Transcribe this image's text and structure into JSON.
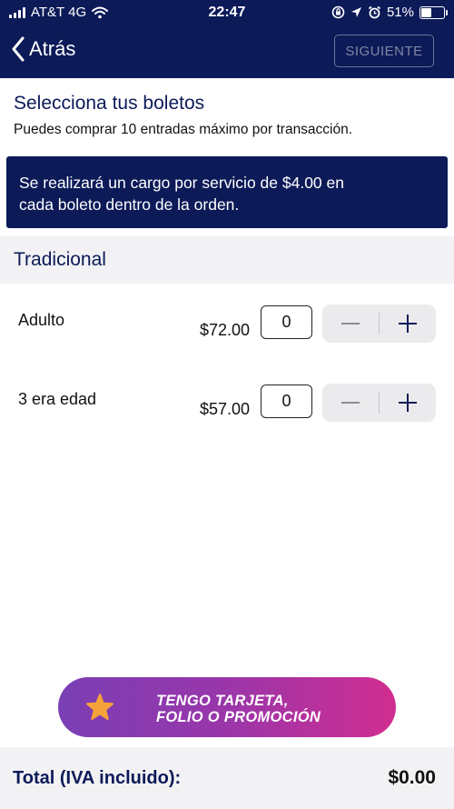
{
  "status_bar": {
    "carrier": "AT&T 4G",
    "time": "22:47",
    "battery": "51%",
    "battery_level": 0.51
  },
  "nav": {
    "back_label": "Atrás",
    "next_label": "SIGUIENTE"
  },
  "intro": {
    "title": "Selecciona tus boletos",
    "subtitle": "Puedes comprar 10 entradas máximo por transacción."
  },
  "notice": {
    "line1": "Se realizará un cargo por servicio de $4.00 en",
    "line2": "cada boleto dentro de la orden."
  },
  "section": {
    "title": "Tradicional"
  },
  "tickets": [
    {
      "name": "Adulto",
      "price": "$72.00",
      "quantity": "0"
    },
    {
      "name": "3 era edad",
      "price": "$57.00",
      "quantity": "0"
    }
  ],
  "promo": {
    "line1": "TENGO TARJETA,",
    "line2": "FOLIO O PROMOCIÓN",
    "icon": "star-icon"
  },
  "footer": {
    "total_label": "Total (IVA incluido):",
    "total_value": "$0.00"
  },
  "colors": {
    "brand_navy": "#0c1a58",
    "promo_start": "#7a3fb4",
    "promo_end": "#d12d90",
    "star": "#f5a23a"
  }
}
